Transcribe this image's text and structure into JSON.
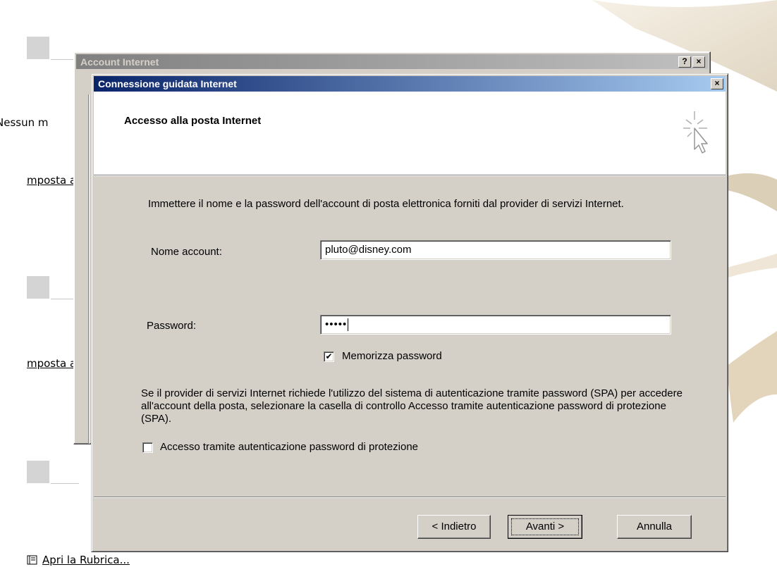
{
  "background": {
    "left_text": "Nessun m",
    "link_1": "mposta a",
    "link_2": "mposta a",
    "bottom_link": "Apri la Rubrica..."
  },
  "back_dialog": {
    "title": "Account Internet",
    "help_button": "?",
    "close_button": "×"
  },
  "wizard": {
    "title": "Connessione guidata Internet",
    "close_button": "×",
    "header_title": "Accesso alla posta Internet",
    "intro_text": "Immettere il nome e la password dell'account di posta elettronica forniti dal provider di servizi Internet.",
    "account": {
      "label": "Nome account:",
      "value": "pluto@disney.com"
    },
    "password": {
      "label": "Password:",
      "masked_value": "•••••"
    },
    "remember_password": {
      "label": "Memorizza password",
      "checked": true,
      "mark": "✔"
    },
    "spa_text": "Se il provider di servizi Internet richiede l'utilizzo del sistema di autenticazione tramite password (SPA) per accedere all'account della posta, selezionare la casella di controllo Accesso tramite autenticazione password di protezione (SPA).",
    "spa_checkbox": {
      "label": "Accesso tramite autenticazione password di protezione",
      "checked": false
    },
    "buttons": {
      "back": "< Indietro",
      "next": "Avanti >",
      "cancel": "Annulla"
    }
  },
  "colors": {
    "active_title_start": "#0a246a",
    "active_title_end": "#a6caf0",
    "inactive_title_start": "#808080",
    "inactive_title_end": "#c0c0c0",
    "dialog_face": "#d4d0c8"
  },
  "icons": [
    "wizard-cursor-icon",
    "address-book-icon"
  ]
}
